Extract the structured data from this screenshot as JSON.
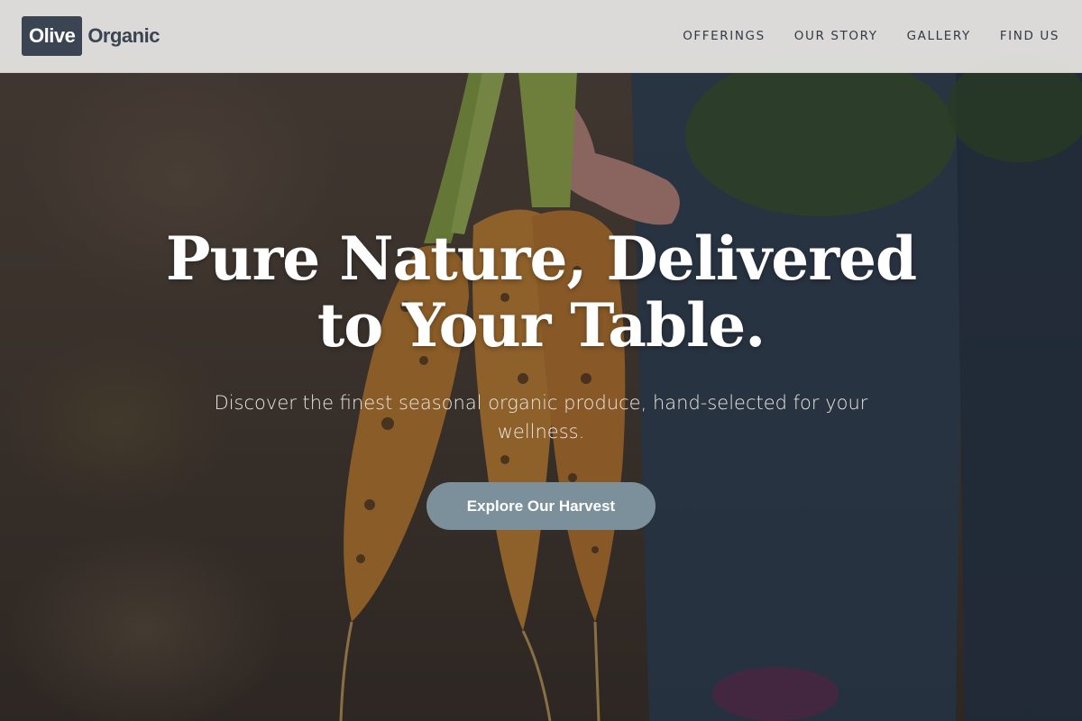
{
  "brand": {
    "logo_box": "Olive",
    "logo_text": "Organic"
  },
  "nav": {
    "items": [
      {
        "label": "OFFERINGS"
      },
      {
        "label": "OUR STORY"
      },
      {
        "label": "GALLERY"
      },
      {
        "label": "FIND US"
      }
    ]
  },
  "hero": {
    "title": "Pure Nature, Delivered to Your Table.",
    "subtitle": "Discover the finest seasonal organic produce, hand-selected for your wellness.",
    "cta_label": "Explore Our Harvest",
    "background_image": "carrots-photo"
  },
  "colors": {
    "logo_bg": "#3b4452",
    "header_bg": "#e8e8e6",
    "cta_bg": "#7c909b",
    "title_text": "#ffffff"
  }
}
